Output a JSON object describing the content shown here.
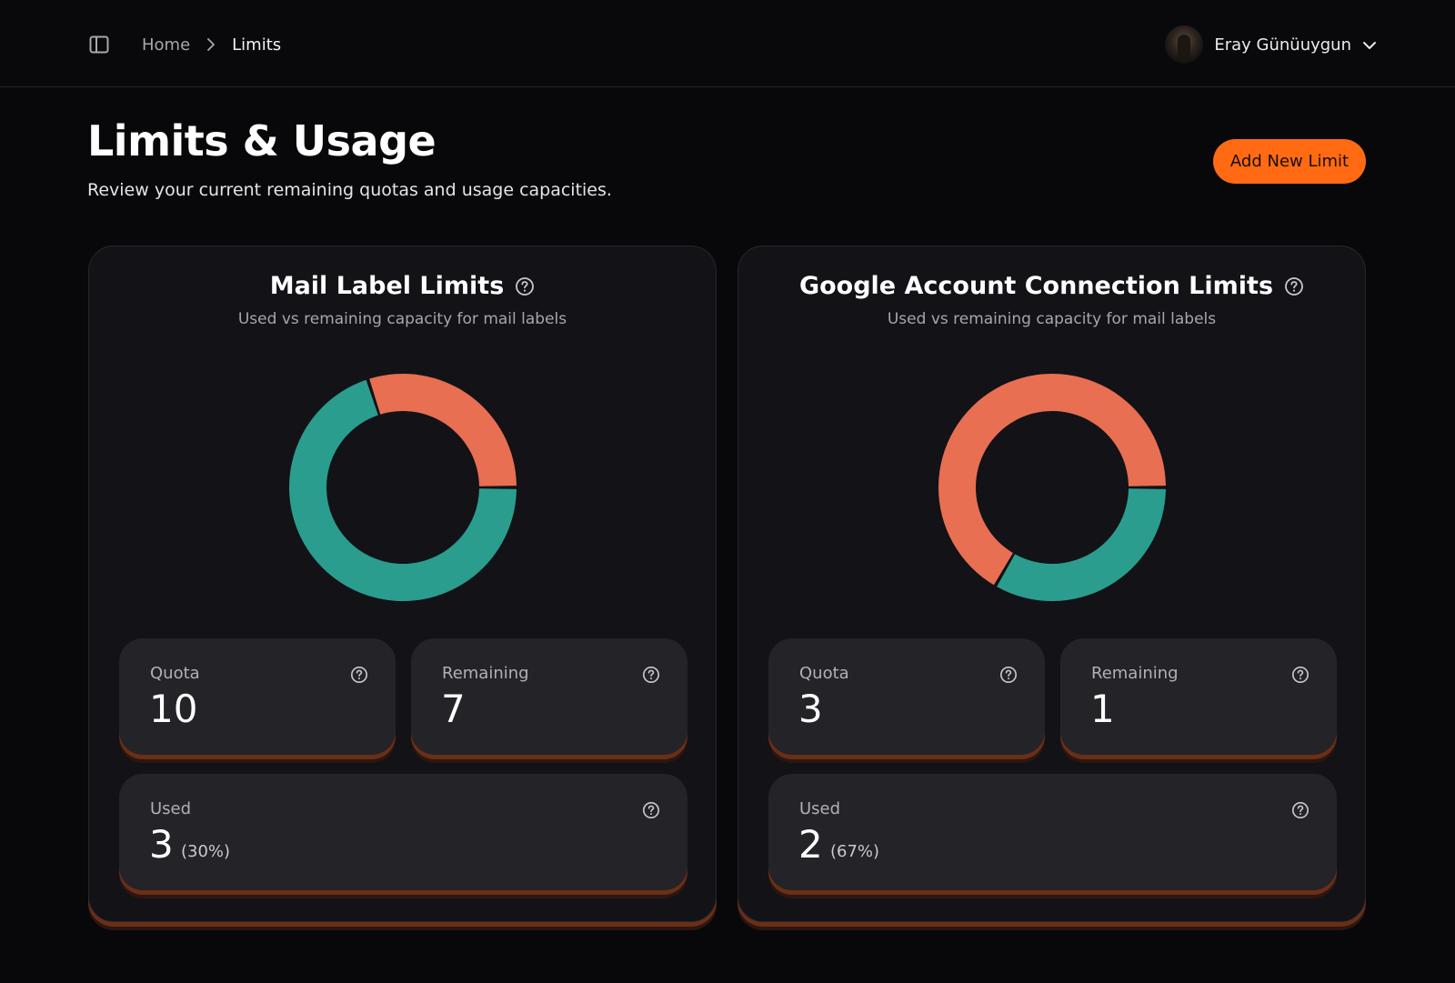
{
  "header": {
    "breadcrumb": {
      "home": "Home",
      "current": "Limits"
    },
    "user": {
      "name": "Eray Günüuygun"
    }
  },
  "page": {
    "title": "Limits & Usage",
    "subtitle": "Review your current remaining quotas and usage capacities.",
    "add_button": "Add New Limit"
  },
  "colors": {
    "accent": "#ff6a12",
    "used": "#e86f52",
    "remaining": "#2a9d8f"
  },
  "cards": [
    {
      "title": "Mail Label Limits",
      "subtitle": "Used vs remaining capacity for mail labels",
      "quota_label": "Quota",
      "quota": "10",
      "remaining_label": "Remaining",
      "remaining": "7",
      "used_label": "Used",
      "used": "3",
      "used_percent": "(30%)"
    },
    {
      "title": "Google Account Connection Limits",
      "subtitle": "Used vs remaining capacity for mail labels",
      "quota_label": "Quota",
      "quota": "3",
      "remaining_label": "Remaining",
      "remaining": "1",
      "used_label": "Used",
      "used": "2",
      "used_percent": "(67%)"
    }
  ],
  "chart_data": [
    {
      "type": "pie",
      "categories": [
        "Used",
        "Remaining"
      ],
      "values": [
        3,
        7
      ]
    },
    {
      "type": "pie",
      "categories": [
        "Used",
        "Remaining"
      ],
      "values": [
        2,
        1
      ]
    }
  ],
  "icons": {
    "sidebar_toggle": "sidebar-toggle-icon",
    "breadcrumb_separator": "chevron-right-icon",
    "user_menu": "chevron-down-icon",
    "help": "help-circle-icon"
  }
}
